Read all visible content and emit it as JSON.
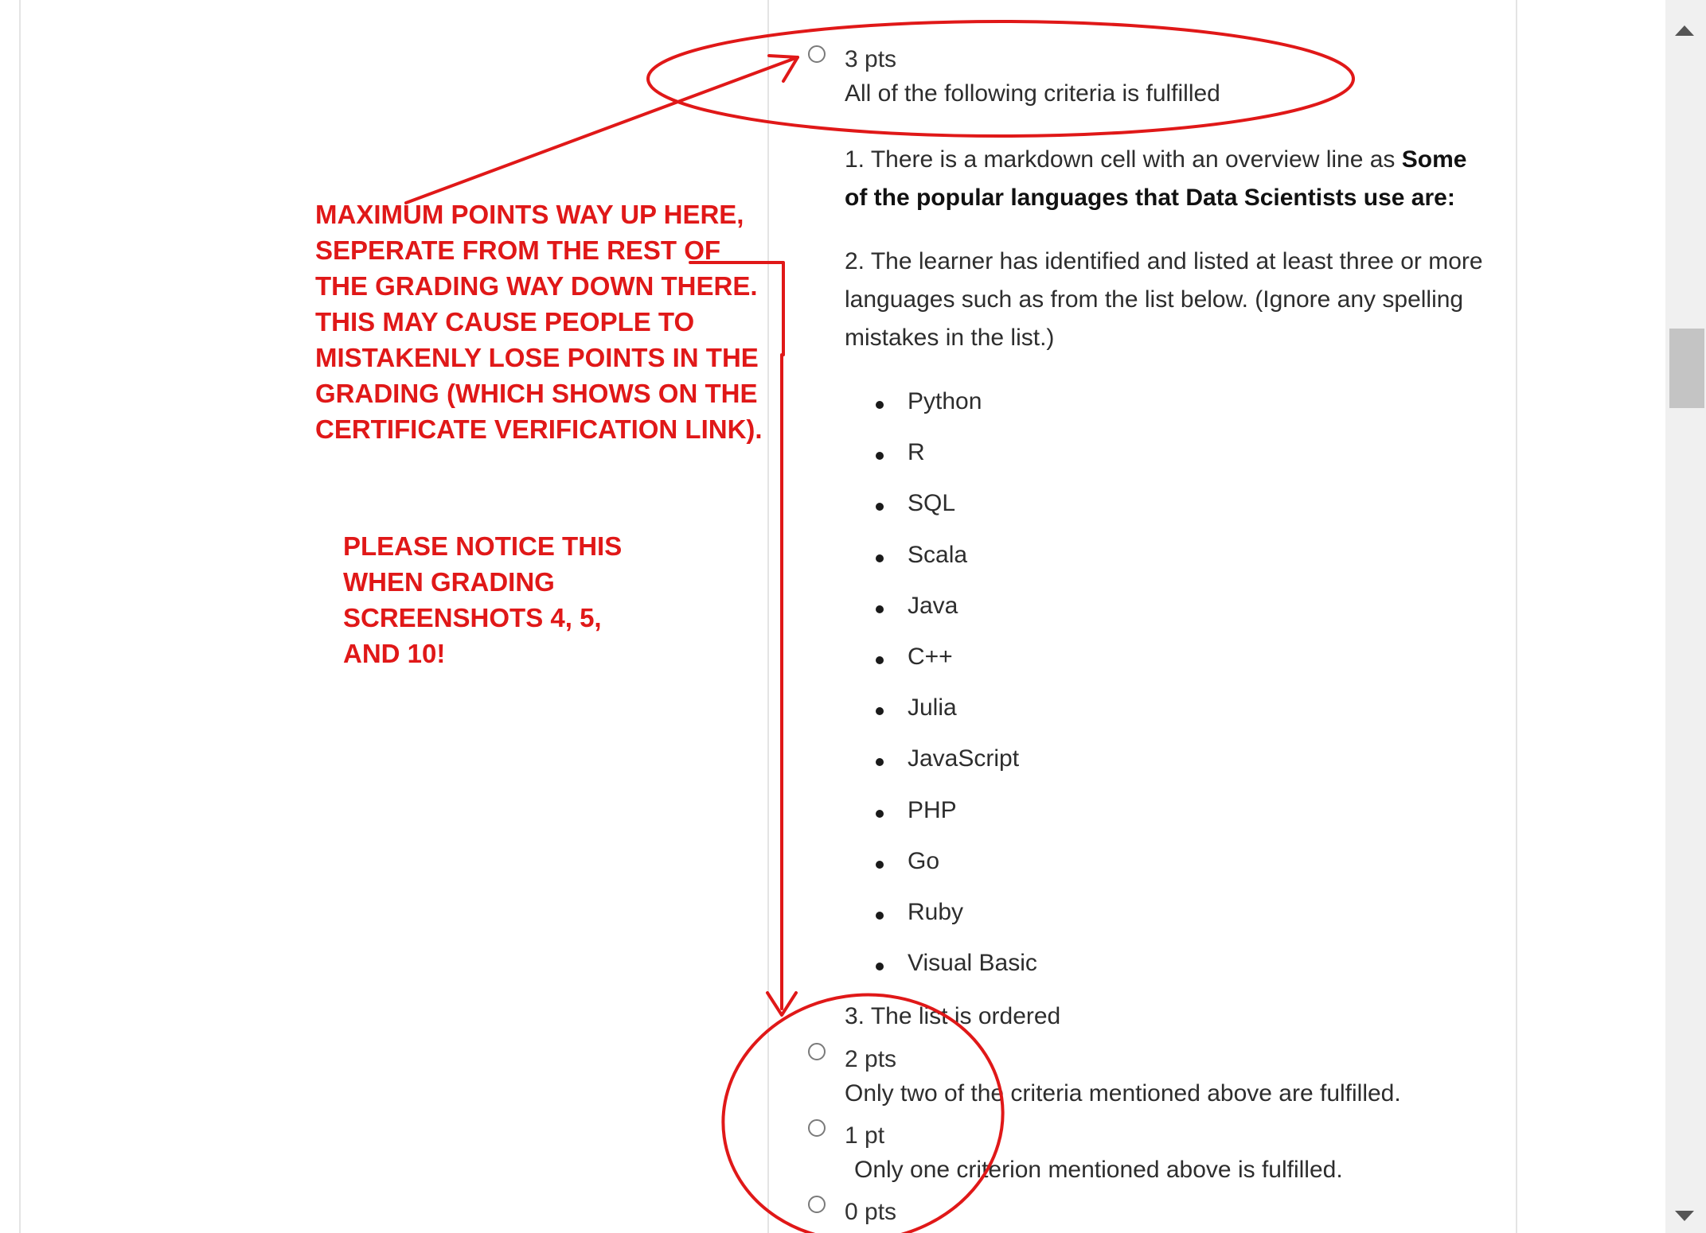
{
  "rubric": {
    "top_option": {
      "points": "3 pts",
      "description": "All of the following criteria is fulfilled"
    },
    "criteria": {
      "item1_prefix": "1. There is a markdown cell with an overview line as ",
      "item1_bold": "Some of the popular languages that Data Scientists use are:",
      "item2": "2. The learner has identified and listed at least three or more languages such as from the list below. (Ignore any spelling mistakes in the list.)",
      "languages": [
        "Python",
        "R",
        "SQL",
        "Scala",
        "Java",
        "C++",
        "Julia",
        "JavaScript",
        "PHP",
        "Go",
        "Ruby",
        "Visual Basic"
      ],
      "item3": "3. The list is ordered"
    },
    "options": [
      {
        "points": "2 pts",
        "description": "Only two of the criteria mentioned above are fulfilled."
      },
      {
        "points": "1 pt",
        "description": "Only one criterion mentioned above is fulfilled."
      },
      {
        "points": "0 pts",
        "description": ""
      }
    ]
  },
  "annotations": {
    "note1": "MAXIMUM POINTS WAY UP HERE, SEPERATE FROM THE REST OF THE GRADING WAY DOWN THERE.  THIS MAY CAUSE PEOPLE TO MISTAKENLY LOSE POINTS IN THE GRADING (WHICH SHOWS ON THE CERTIFICATE VERIFICATION LINK).",
    "note2": "PLEASE NOTICE THIS WHEN GRADING SCREENSHOTS 4, 5, AND 10!",
    "color": "#e01818"
  },
  "scrollbar": {
    "up_icon": "triangle-up-icon",
    "down_icon": "triangle-down-icon"
  }
}
